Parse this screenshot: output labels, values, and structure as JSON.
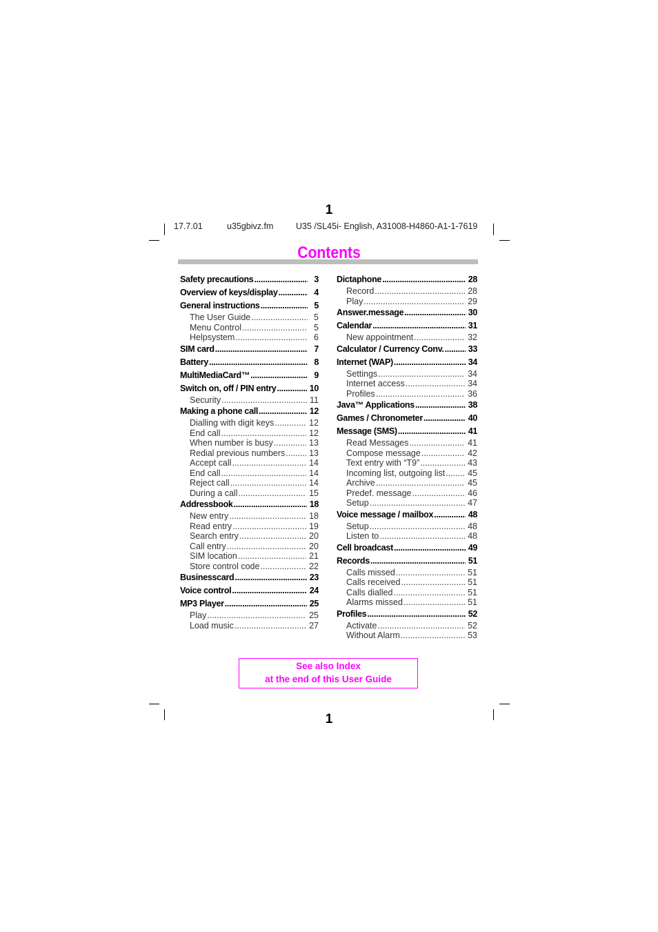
{
  "page_number_top": "1",
  "page_number_bottom": "1",
  "header": {
    "date": "17.7.01",
    "filename": "u35gbivz.fm",
    "doc_id": "U35 /SL45i- English, A31008-H4860-A1-1-7619"
  },
  "title": "Contents",
  "accent_color": "#ff00ff",
  "toc_left": [
    {
      "label": "Safety precautions",
      "page": "3",
      "level": "main"
    },
    {
      "label": "Overview of keys/display",
      "page": "4",
      "level": "main"
    },
    {
      "label": "General instructions",
      "page": "5",
      "level": "main"
    },
    {
      "label": "The User Guide",
      "page": "5",
      "level": "sub"
    },
    {
      "label": "Menu Control",
      "page": "5",
      "level": "sub"
    },
    {
      "label": "Helpsystem",
      "page": "6",
      "level": "sub"
    },
    {
      "label": "SIM card",
      "page": "7",
      "level": "main"
    },
    {
      "label": "Battery",
      "page": "8",
      "level": "main"
    },
    {
      "label": "MultiMediaCard™",
      "page": "9",
      "level": "main"
    },
    {
      "label": "Switch on, off / PIN entry",
      "page": "10",
      "level": "main"
    },
    {
      "label": "Security",
      "page": "11",
      "level": "sub"
    },
    {
      "label": "Making a phone call",
      "page": "12",
      "level": "main"
    },
    {
      "label": "Dialling with digit keys",
      "page": "12",
      "level": "sub"
    },
    {
      "label": "End call",
      "page": "12",
      "level": "sub"
    },
    {
      "label": "When number is busy",
      "page": "13",
      "level": "sub"
    },
    {
      "label": "Redial previous numbers",
      "page": "13",
      "level": "sub"
    },
    {
      "label": "Accept call",
      "page": "14",
      "level": "sub"
    },
    {
      "label": "End call",
      "page": "14",
      "level": "sub"
    },
    {
      "label": "Reject call",
      "page": "14",
      "level": "sub"
    },
    {
      "label": "During a call",
      "page": "15",
      "level": "sub"
    },
    {
      "label": "Addressbook",
      "page": "18",
      "level": "main"
    },
    {
      "label": "New entry",
      "page": "18",
      "level": "sub"
    },
    {
      "label": "Read entry",
      "page": "19",
      "level": "sub"
    },
    {
      "label": "Search entry",
      "page": "20",
      "level": "sub"
    },
    {
      "label": "Call entry",
      "page": "20",
      "level": "sub"
    },
    {
      "label": "SIM location",
      "page": "21",
      "level": "sub"
    },
    {
      "label": "Store control code",
      "page": "22",
      "level": "sub"
    },
    {
      "label": "Businesscard",
      "page": "23",
      "level": "main"
    },
    {
      "label": "Voice control",
      "page": "24",
      "level": "main"
    },
    {
      "label": "MP3 Player",
      "page": "25",
      "level": "main"
    },
    {
      "label": "Play",
      "page": "25",
      "level": "sub"
    },
    {
      "label": "Load music",
      "page": "27",
      "level": "sub"
    }
  ],
  "toc_right": [
    {
      "label": "Dictaphone",
      "page": "28",
      "level": "main"
    },
    {
      "label": "Record",
      "page": "28",
      "level": "sub"
    },
    {
      "label": "Play",
      "page": "29",
      "level": "sub"
    },
    {
      "label": "Answer.message",
      "page": "30",
      "level": "main"
    },
    {
      "label": "Calendar",
      "page": "31",
      "level": "main"
    },
    {
      "label": "New appointment",
      "page": "32",
      "level": "sub"
    },
    {
      "label": "Calculator / Currency Conv.",
      "page": "33",
      "level": "main"
    },
    {
      "label": "Internet (WAP)",
      "page": "34",
      "level": "main"
    },
    {
      "label": "Settings",
      "page": "34",
      "level": "sub"
    },
    {
      "label": "Internet access",
      "page": "34",
      "level": "sub"
    },
    {
      "label": "Profiles",
      "page": "36",
      "level": "sub"
    },
    {
      "label": "Java™ Applications",
      "page": "38",
      "level": "main"
    },
    {
      "label": "Games / Chronometer",
      "page": "40",
      "level": "main"
    },
    {
      "label": "Message (SMS)",
      "page": "41",
      "level": "main"
    },
    {
      "label": "Read Messages",
      "page": "41",
      "level": "sub"
    },
    {
      "label": "Compose message",
      "page": "42",
      "level": "sub"
    },
    {
      "label": "Text entry with “T9”",
      "page": "43",
      "level": "sub"
    },
    {
      "label": "Incoming list, outgoing list",
      "page": "45",
      "level": "sub"
    },
    {
      "label": "Archive",
      "page": "45",
      "level": "sub"
    },
    {
      "label": "Predef. message",
      "page": "46",
      "level": "sub"
    },
    {
      "label": "Setup",
      "page": "47",
      "level": "sub"
    },
    {
      "label": "Voice message / mailbox",
      "page": "48",
      "level": "main"
    },
    {
      "label": "Setup",
      "page": "48",
      "level": "sub"
    },
    {
      "label": "Listen to",
      "page": "48",
      "level": "sub"
    },
    {
      "label": "Cell broadcast",
      "page": "49",
      "level": "main"
    },
    {
      "label": "Records",
      "page": "51",
      "level": "main"
    },
    {
      "label": "Calls missed",
      "page": "51",
      "level": "sub"
    },
    {
      "label": "Calls received",
      "page": "51",
      "level": "sub"
    },
    {
      "label": "Calls dialled",
      "page": "51",
      "level": "sub"
    },
    {
      "label": "Alarms missed",
      "page": "51",
      "level": "sub"
    },
    {
      "label": "Profiles",
      "page": "52",
      "level": "main"
    },
    {
      "label": "Activate",
      "page": "52",
      "level": "sub"
    },
    {
      "label": "Without Alarm",
      "page": "53",
      "level": "sub"
    }
  ],
  "note": {
    "line1": "See also Index",
    "line2": "at the end of this User Guide"
  }
}
